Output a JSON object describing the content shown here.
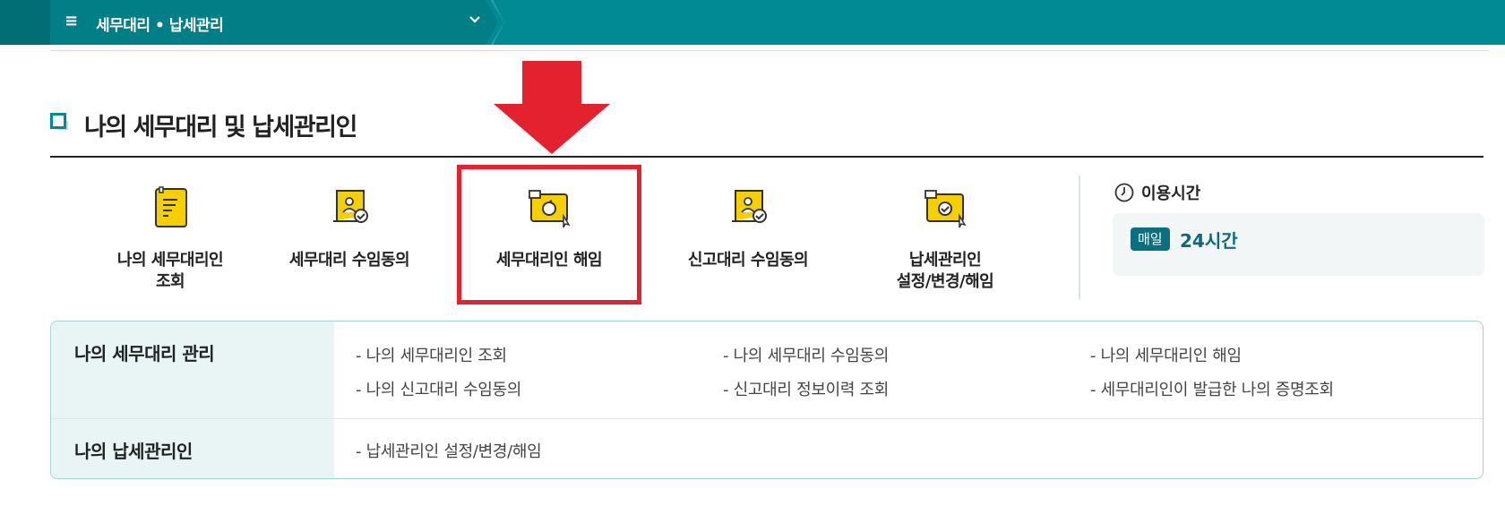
{
  "nav": {
    "menu_icon": "≡",
    "breadcrumb": "세무대리 • 납세관리",
    "chevron": "⌄"
  },
  "section": {
    "title": "나의 세무대리 및 납세관리인"
  },
  "tiles": [
    {
      "label": "나의 세무대리인\n조회",
      "icon": "document-icon"
    },
    {
      "label": "세무대리 수임동의",
      "icon": "scroll-user-check-icon"
    },
    {
      "label": "세무대리인 해임",
      "icon": "monitor-refresh-icon"
    },
    {
      "label": "신고대리 수임동의",
      "icon": "scroll-user-check-icon"
    },
    {
      "label": "납세관리인\n설정/변경/해임",
      "icon": "monitor-check-icon"
    }
  ],
  "usage": {
    "title": "이용시간",
    "badge": "매일",
    "value": "24시간"
  },
  "links_table": {
    "rows": [
      {
        "heading": "나의 세무대리 관리",
        "links": [
          "나의 세무대리인 조회",
          "나의 세무대리 수임동의",
          "나의 세무대리인 해임",
          "나의 신고대리 수임동의",
          "신고대리 정보이력 조회",
          "세무대리인이 발급한 나의 증명조회"
        ]
      },
      {
        "heading": "나의 납세관리인",
        "links": [
          "납세관리인 설정/변경/해임"
        ]
      }
    ]
  },
  "colors": {
    "teal": "#018a93",
    "highlight_red": "#e4212e",
    "icon_yellow": "#f5cf00"
  }
}
